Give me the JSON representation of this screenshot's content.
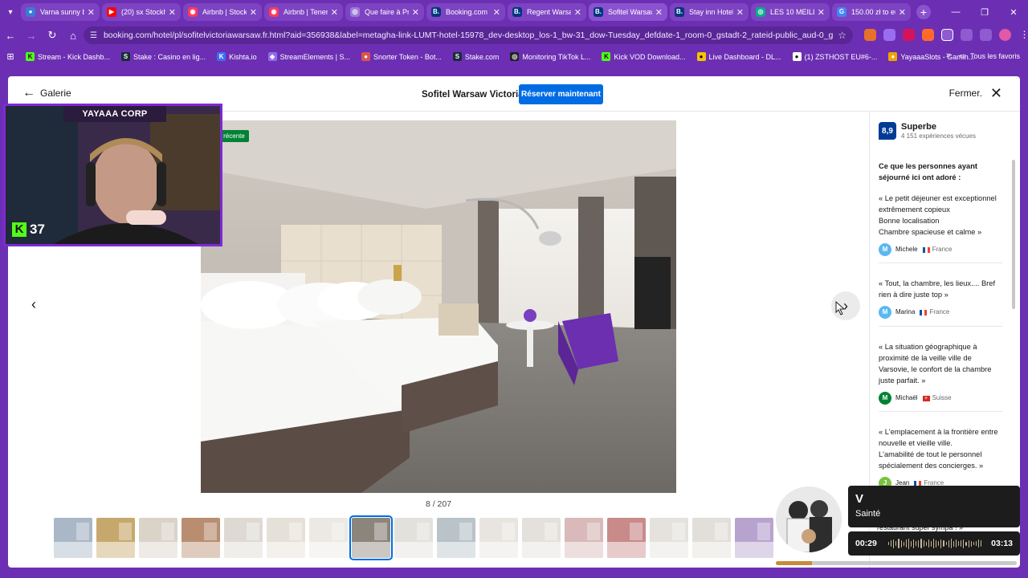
{
  "browser": {
    "tabs": [
      {
        "title": "Varna sunny be",
        "color": "#3a7bd5",
        "glyph": "●"
      },
      {
        "title": "(20) sx Stockho",
        "color": "#ff0000",
        "glyph": "▶"
      },
      {
        "title": "Airbnb | Stockh",
        "color": "#ff385c",
        "glyph": "◉"
      },
      {
        "title": "Airbnb | Tenerif",
        "color": "#ff385c",
        "glyph": "◉"
      },
      {
        "title": "Que faire à Pra",
        "color": "#9b7ad8",
        "glyph": "◎"
      },
      {
        "title": "Booking.com",
        "color": "#003580",
        "glyph": "B."
      },
      {
        "title": "Regent Warsaw",
        "color": "#003580",
        "glyph": "B."
      },
      {
        "title": "Sofitel Warsaw",
        "color": "#003580",
        "glyph": "B.",
        "active": true
      },
      {
        "title": "Stay inn Hotel",
        "color": "#003580",
        "glyph": "B."
      },
      {
        "title": "LES 10 MEILLE",
        "color": "#00af87",
        "glyph": "◎"
      },
      {
        "title": "150.00 zł to eu",
        "color": "#4285f4",
        "glyph": "G"
      }
    ],
    "url": "booking.com/hotel/pl/sofitelvictoriawarsaw.fr.html?aid=356938&label=metagha-link-LUMT-hotel-15978_dev-desktop_los-1_bw-31_dow-Tuesday_defdate-1_room-0_gstadt-2_rateid-public_aud-0_gacid-21404706195_m...",
    "bookmarks": [
      {
        "label": "Stream - Kick Dashb...",
        "color": "#53fc18",
        "glyph": "K"
      },
      {
        "label": "Stake : Casino en lig...",
        "color": "#1a2c38",
        "glyph": "S"
      },
      {
        "label": "Kishta.io",
        "color": "#3b6ef5",
        "glyph": "K"
      },
      {
        "label": "StreamElements | S...",
        "color": "#8c6cf0",
        "glyph": "◈"
      },
      {
        "label": "Snorter Token - Bot...",
        "color": "#d9534f",
        "glyph": "●"
      },
      {
        "label": "Stake.com",
        "color": "#1a2c38",
        "glyph": "S"
      },
      {
        "label": "Monitoring TikTok L...",
        "color": "#222222",
        "glyph": "◎"
      },
      {
        "label": "Kick VOD Download...",
        "color": "#53fc18",
        "glyph": "K"
      },
      {
        "label": "Live Dashboard - DL...",
        "color": "#f5c400",
        "glyph": "●"
      },
      {
        "label": "(1) ZSTHOST EU#6-...",
        "color": "#ffffff",
        "glyph": "●"
      },
      {
        "label": "YayaaaSlots - Gamin...",
        "color": "#f0a500",
        "glyph": "●"
      }
    ],
    "all_bookmarks": "Tous les favoris"
  },
  "gallery": {
    "back_label": "Galerie",
    "hotel_name": "Sofitel Warsaw Victoria",
    "reserve_label": "Réserver maintenant",
    "close_label": "Fermer.",
    "photo_badge": "Photo récente",
    "counter": "8 / 207",
    "selected_thumb_index": 7,
    "thumb_count": 17
  },
  "reviews": {
    "score": "8,9",
    "score_label": "Superbe",
    "score_count": "4 151 expériences vécues",
    "liked_title": "Ce que les personnes ayant séjourné ici ont adoré :",
    "items": [
      {
        "quote": "« Le petit déjeuner est exceptionnel\nextrêmement copieux\nBonne localisation\nChambre spacieuse et calme »",
        "name": "Michele",
        "initial": "M",
        "avatar_color": "#5bb8f0",
        "country": "France"
      },
      {
        "quote": "« Tout, la chambre, les lieux.... Bref rien à dire juste top »",
        "name": "Marina",
        "initial": "M",
        "avatar_color": "#5bb8f0",
        "country": "France"
      },
      {
        "quote": "« La situation géographique à proximité de la veille ville de Varsovie, le confort de la chambre juste parfait. »",
        "name": "Michaël",
        "initial": "M",
        "avatar_color": "#008234",
        "country": "Suisse"
      },
      {
        "quote": "« L'emplacement à la frontière entre nouvelle et vieille ville.\nL'amabilité de tout le personnel spécialement des concierges. »",
        "name": "Jean",
        "initial": "J",
        "avatar_color": "#7ac143",
        "country": "France"
      }
    ],
    "partial_next": "restaurant super sympa ! »"
  },
  "stream": {
    "webcam_title": "YAYAAA CORP",
    "kick_count": "37"
  },
  "player": {
    "title": "V",
    "artist": "Sainté",
    "current": "00:29",
    "duration": "03:13",
    "progress": 0.15
  }
}
